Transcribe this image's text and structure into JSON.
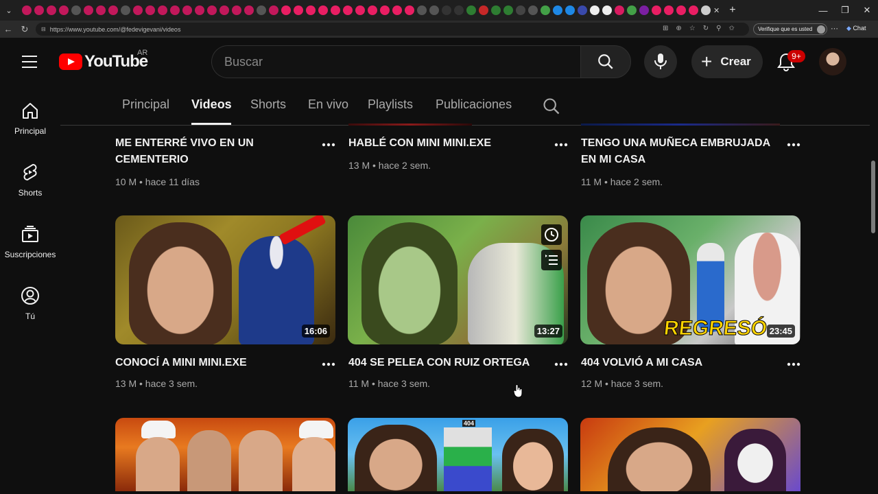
{
  "browser": {
    "url": "https://www.youtube.com/@fedevigevani/videos",
    "verify_label": "Verifique que es usted",
    "chat_label": "Chat"
  },
  "masthead": {
    "logo_text": "YouTube",
    "region": "AR",
    "search_placeholder": "Buscar",
    "create_label": "Crear",
    "notifications_count": "9+"
  },
  "sidebar": {
    "items": [
      {
        "label": "Principal",
        "icon": "home-icon"
      },
      {
        "label": "Shorts",
        "icon": "shorts-icon"
      },
      {
        "label": "Suscripciones",
        "icon": "subscriptions-icon"
      },
      {
        "label": "Tú",
        "icon": "you-icon"
      }
    ]
  },
  "channel_tabs": [
    "Principal",
    "Videos",
    "Shorts",
    "En vivo",
    "Playlists",
    "Publicaciones"
  ],
  "active_tab": "Videos",
  "videos_row1": [
    {
      "title": "ME ENTERRÉ VIVO EN UN CEMENTERIO",
      "meta": "10 M • hace 11 días"
    },
    {
      "title": "HABLÉ CON MINI MINI.EXE",
      "meta": "13 M • hace 2 sem."
    },
    {
      "title": "TENGO UNA MUÑECA EMBRUJADA EN MI CASA",
      "meta": "11 M • hace 2 sem."
    }
  ],
  "videos_row2": [
    {
      "title": "CONOCÍ A MINI MINI.EXE",
      "meta": "13 M • hace 3 sem.",
      "duration": "16:06"
    },
    {
      "title": "404 SE PELEA CON RUIZ ORTEGA",
      "meta": "11 M • hace 3 sem.",
      "duration": "13:27"
    },
    {
      "title": "404 VOLVIÓ A MI CASA",
      "meta": "12 M • hace 3 sem.",
      "duration": "23:45",
      "overlay_text": "REGRESÓ"
    }
  ],
  "row3_overlay_text": "404"
}
